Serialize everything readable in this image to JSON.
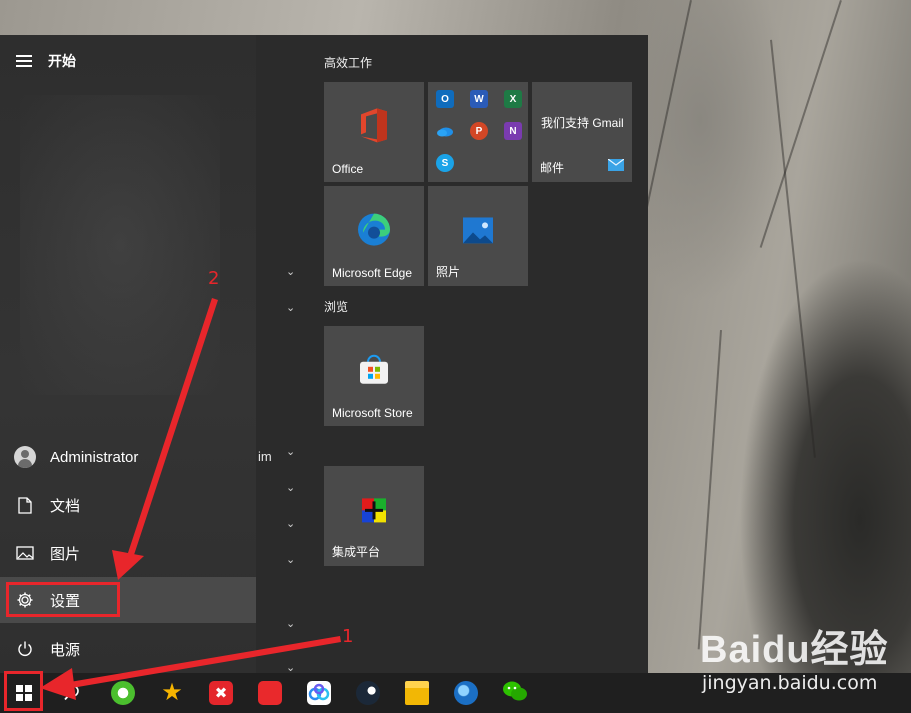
{
  "start_menu": {
    "title": "开始",
    "left_items": [
      {
        "label": "Administrator",
        "icon": "user-avatar-icon"
      },
      {
        "label": "文档",
        "icon": "document-icon"
      },
      {
        "label": "图片",
        "icon": "picture-icon"
      },
      {
        "label": "设置",
        "icon": "gear-icon",
        "selected": true
      },
      {
        "label": "电源",
        "icon": "power-icon"
      }
    ],
    "app_list_clipped_text": "im",
    "groups": {
      "productivity": "高效工作",
      "browse": "浏览"
    },
    "tiles": {
      "office": "Office",
      "gmail_promo": "我们支持 Gmail",
      "mail": "邮件",
      "edge": "Microsoft Edge",
      "photos": "照片",
      "store": "Microsoft Store",
      "integration_platform": "集成平台"
    },
    "office_mini_apps": [
      "outlook-icon",
      "word-icon",
      "excel-icon",
      "onedrive-icon",
      "powerpoint-icon",
      "onenote-icon",
      "skype-icon"
    ]
  },
  "taskbar": {
    "apps": [
      "start-icon",
      "search-icon",
      "ie-browser-icon",
      "game-star-icon",
      "xmind-icon",
      "cloud-drive-icon",
      "baidu-netdisk-icon",
      "steam-icon",
      "file-explorer-icon",
      "browser-globe-icon",
      "wechat-icon"
    ]
  },
  "annotations": {
    "step1": "1",
    "step2": "2"
  },
  "watermark": {
    "logo_text": "Baidu经验",
    "url": "jingyan.baidu.com"
  },
  "colors": {
    "annotation_red": "#e8262b",
    "menu_bg": "#2b2b2b",
    "tile_bg": "#4a4a4a",
    "taskbar_bg": "#1f1f1f"
  }
}
